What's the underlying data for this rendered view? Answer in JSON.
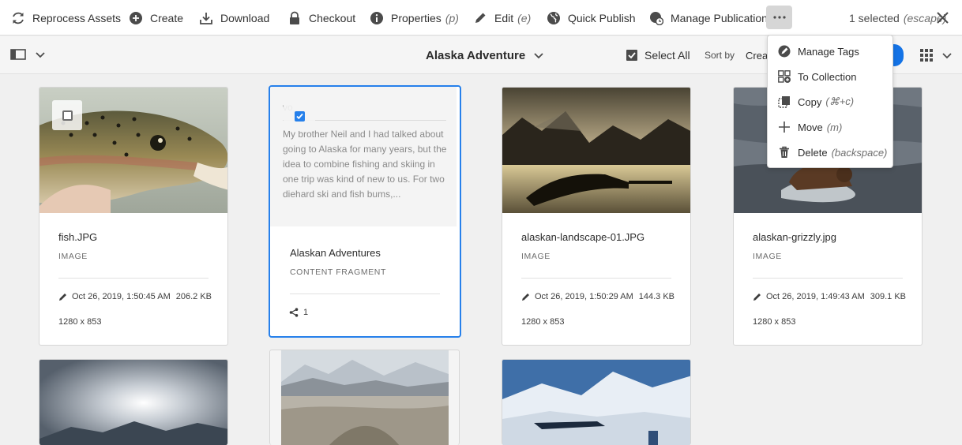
{
  "toolbar": {
    "reprocess": "Reprocess Assets",
    "create": "Create",
    "download": "Download",
    "checkout": "Checkout",
    "properties": "Properties",
    "properties_key": "(p)",
    "edit": "Edit",
    "edit_key": "(e)",
    "quick_publish": "Quick Publish",
    "manage_publication": "Manage Publication",
    "more_label": "•••",
    "selected_count": "1 selected",
    "escape_key": "(escape)"
  },
  "subheader": {
    "folder_title": "Alaska Adventure",
    "select_all": "Select All",
    "sort_by_label": "Sort by",
    "sort_by_value": "Creat"
  },
  "more_menu": {
    "items": [
      {
        "label": "Manage Tags",
        "key": "",
        "icon": "tag-icon"
      },
      {
        "label": "To Collection",
        "key": "",
        "icon": "collection-add-icon"
      },
      {
        "label": "Copy",
        "key": "(⌘+c)",
        "icon": "copy-icon"
      },
      {
        "label": "Move",
        "key": "(m)",
        "icon": "move-icon"
      },
      {
        "label": "Delete",
        "key": "(backspace)",
        "icon": "delete-icon"
      }
    ]
  },
  "cards": [
    {
      "title": "fish.JPG",
      "type": "IMAGE",
      "modified": "Oct 26, 2019, 1:50:45 AM",
      "size": "206.2 KB",
      "dimensions": "1280 x 853",
      "selected": false
    },
    {
      "title": "Alaskan Adventures",
      "type": "CONTENT FRAGMENT",
      "preview_heading": "vo",
      "preview_text": "My brother Neil and I had talked about going to Alaska for many years, but the idea to combine fishing and skiing in one trip was kind of new to us. For two diehard ski and fish bums,...",
      "share_count": "1",
      "selected": true
    },
    {
      "title": "alaskan-landscape-01.JPG",
      "type": "IMAGE",
      "modified": "Oct 26, 2019, 1:50:29 AM",
      "size": "144.3 KB",
      "dimensions": "1280 x 853",
      "selected": false
    },
    {
      "title": "alaskan-grizzly.jpg",
      "type": "IMAGE",
      "modified": "Oct 26, 2019, 1:49:43 AM",
      "size": "309.1 KB",
      "dimensions": "1280 x 853",
      "selected": false
    }
  ],
  "colors": {
    "accent": "#2680eb",
    "background": "#f0f0f0"
  }
}
